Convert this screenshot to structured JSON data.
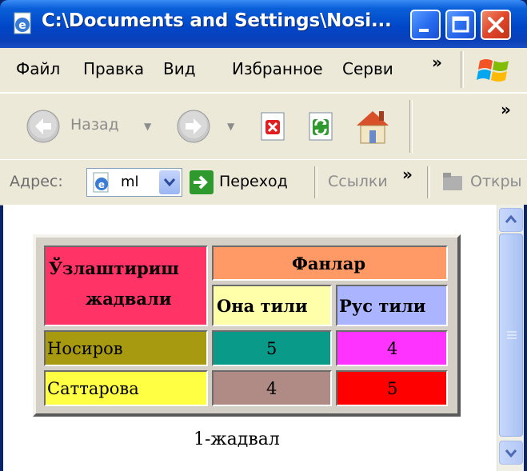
{
  "window": {
    "title": "C:\\Documents and Settings\\Nosi..."
  },
  "menubar": {
    "items": [
      "Файл",
      "Правка",
      "Вид",
      "Избранное",
      "Серви"
    ],
    "more": "»"
  },
  "toolbar": {
    "back_label": "Назад",
    "more": "»"
  },
  "addressbar": {
    "label": "Адрес:",
    "value": "ml",
    "go_label": "Переход",
    "links_label": "Ссылки",
    "links_more": "»",
    "open_label": "Откры"
  },
  "table": {
    "header_left": [
      "Ўзлаштириш",
      "жадвали"
    ],
    "header_group": "Фанлар",
    "col1": "Она тили",
    "col2": "Рус тили",
    "rows": [
      {
        "name": "Носиров",
        "v1": "5",
        "v2": "4"
      },
      {
        "name": "Саттарова",
        "v1": "4",
        "v2": "5"
      }
    ],
    "colors": {
      "header_left": "#ff3366",
      "header_group": "#ff9966",
      "col1": "#ffffaa",
      "col2": "#aab4ff",
      "row1_name": "#a89a10",
      "row1_v1": "#0a9a8a",
      "row1_v2": "#ff33ff",
      "row2_name": "#ffff44",
      "row2_v1": "#b08a84",
      "row2_v2": "#ff0000"
    }
  },
  "caption": "1-жадвал"
}
